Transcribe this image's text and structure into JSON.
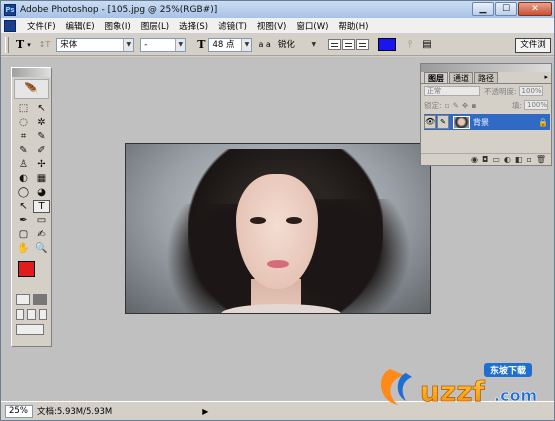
{
  "window": {
    "title": "Adobe Photoshop - [105.jpg @ 25%(RGB#)]",
    "app_icon": "Ps",
    "controls": [
      "minimize",
      "maximize",
      "close"
    ],
    "minimize_label": "▁",
    "maximize_label": "☐",
    "close_label": "✕"
  },
  "menubar": {
    "items": [
      "文件(F)",
      "编辑(E)",
      "图象(I)",
      "图层(L)",
      "选择(S)",
      "滤镜(T)",
      "视图(V)",
      "窗口(W)",
      "帮助(H)"
    ]
  },
  "options": {
    "tool_symbol": "T",
    "orientation_symbol": "↕T",
    "font_family": "宋体",
    "font_style": "-",
    "size_symbol": "T",
    "font_size": "48 点",
    "aa_symbol": "a a",
    "antialias": "锐化",
    "color": "#1a14f0",
    "file_browser": "文件浏"
  },
  "toolbox": {
    "feather_icon": "🪶",
    "tools": [
      "⬚",
      "↖",
      "◌",
      "✲",
      "⌗",
      "✎",
      "✎",
      "✐",
      "♙",
      "✢",
      "◐",
      "▦",
      "◯",
      "◕",
      "↖",
      "T",
      "✒",
      "▭",
      "▢",
      "✍",
      "✋",
      "🔍"
    ],
    "fg_color": "#e01c1c",
    "bg_color": "#ffffff"
  },
  "layers_panel": {
    "tabs": [
      "图层",
      "通道",
      "路径"
    ],
    "blend_mode": "正常",
    "opacity_label": "不透明度:",
    "opacity_value": "100%",
    "lock_label": "锁定:",
    "fill_label": "填:",
    "fill_value": "100%",
    "menu_arrow": "▸",
    "layer_name": "背景",
    "eye_icon": "👁",
    "brush_icon": "✎",
    "lock_icon": "🔒",
    "footer_icons": [
      "◉",
      "◘",
      "▭",
      "◐",
      "◧",
      "▫",
      "🗑"
    ]
  },
  "statusbar": {
    "zoom": "25%",
    "doc_info": "文档:5.93M/5.93M",
    "play_icon": "▶"
  },
  "watermark": {
    "tagline": "东坡下载",
    "brand": "uzzf",
    "domain_suffix": ".com"
  }
}
